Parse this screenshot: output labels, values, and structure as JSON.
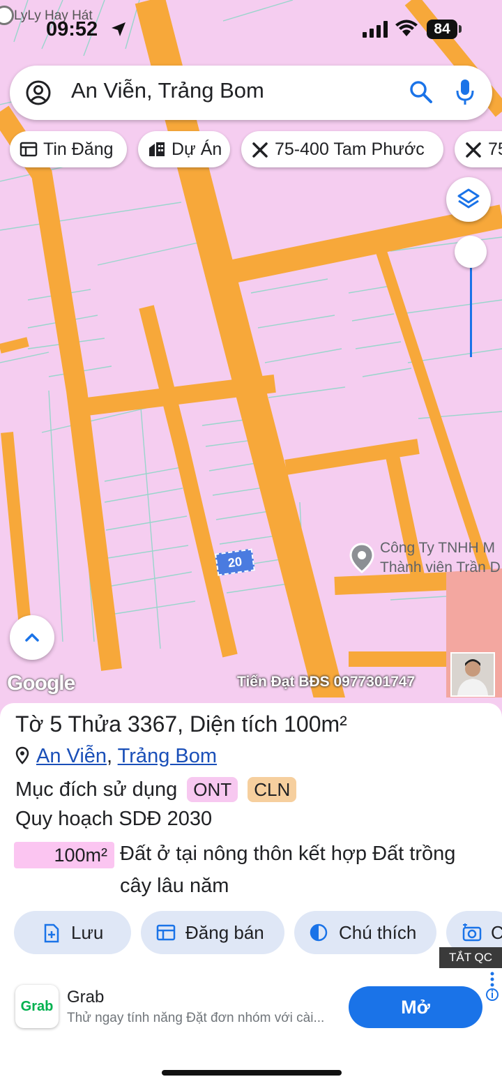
{
  "status_bar": {
    "carrier": "LyLy Hay Hát",
    "time": "09:52",
    "battery": "84"
  },
  "search": {
    "query": "An Viễn, Trảng Bom"
  },
  "chips": [
    {
      "label": "Tin Đăng",
      "icon": "listing-icon"
    },
    {
      "label": "Dự Án",
      "icon": "building-icon"
    },
    {
      "label": "75-400 Tam Phước",
      "icon": "tools-icon"
    },
    {
      "label": "75",
      "icon": "tools-icon"
    }
  ],
  "map": {
    "parcel_label": "20",
    "poi_line1": "Công Ty TNHH M",
    "poi_line2": "Thành viên Trần D",
    "logo": "Google",
    "watermark": "Tiến Đạt BĐS 0977301747"
  },
  "parcel": {
    "title": "Tờ 5 Thửa 3367, Diện tích 100m²",
    "commune": "An Viễn",
    "separator": ", ",
    "district": "Trảng Bom",
    "usage_label": "Mục đích sử dụng",
    "usage_codes": [
      "ONT",
      "CLN"
    ],
    "plan_label": "Quy hoạch SDĐ 2030",
    "plan_area": "100m²",
    "plan_desc_line1": "Đất ở tại nông thôn kết hợp Đất trồng",
    "plan_desc_line2": "cây lâu năm"
  },
  "actions": [
    {
      "label": "Lưu",
      "icon": "save-icon"
    },
    {
      "label": "Đăng bán",
      "icon": "post-sale-icon"
    },
    {
      "label": "Chú thích",
      "icon": "legend-icon"
    },
    {
      "label": "C",
      "icon": "camera-icon"
    }
  ],
  "ad": {
    "close_label": "TẮT QC",
    "brand": "Grab",
    "title": "Grab",
    "text": "Thử ngay tính năng Đặt đơn nhóm với cài...",
    "button": "Mở"
  },
  "colors": {
    "parcel": "#f5cdf0",
    "road": "#f7a83a",
    "accent": "#1a73e8",
    "button_bg": "#dfe7f6"
  }
}
